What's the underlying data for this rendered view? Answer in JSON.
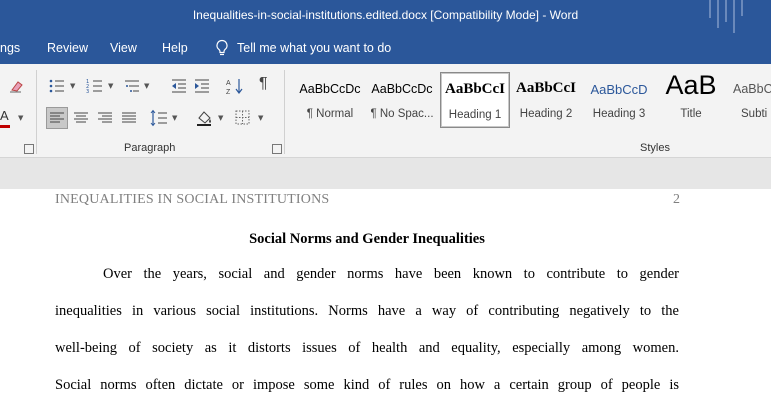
{
  "window": {
    "title": "Inequalities-in-social-institutions.edited.docx [Compatibility Mode]  -  Word"
  },
  "menu": {
    "tabs": [
      "ngs",
      "Review",
      "View",
      "Help"
    ],
    "tell_me": "Tell me what you want to do"
  },
  "ribbon": {
    "paragraph_label": "Paragraph",
    "styles_label": "Styles",
    "styles": [
      {
        "preview": "AaBbCcDc",
        "name": "¶ Normal"
      },
      {
        "preview": "AaBbCcDc",
        "name": "¶ No Spac..."
      },
      {
        "preview": "AaBbCcI",
        "name": "Heading 1"
      },
      {
        "preview": "AaBbCcI",
        "name": "Heading 2"
      },
      {
        "preview": "AaBbCcD",
        "name": "Heading 3"
      },
      {
        "preview": "AaB",
        "name": "Title"
      },
      {
        "preview": "AaBbC",
        "name": "Subti"
      }
    ],
    "selected_style": "Heading 1",
    "colors": {
      "accent": "#2b579a",
      "font_color": "#c00000"
    }
  },
  "document": {
    "header": "INEQUALITIES IN SOCIAL INSTITUTIONS",
    "page_number": "2",
    "title": "Social Norms and Gender Inequalities",
    "lines": [
      "Over the years, social and gender norms have been known to contribute to gender",
      "inequalities in various social institutions. Norms have a way of contributing negatively to the",
      "well-being of society as it distorts issues of health and equality, especially among women.",
      "Social norms often dictate or impose some kind of rules on how a certain group of people is"
    ]
  }
}
